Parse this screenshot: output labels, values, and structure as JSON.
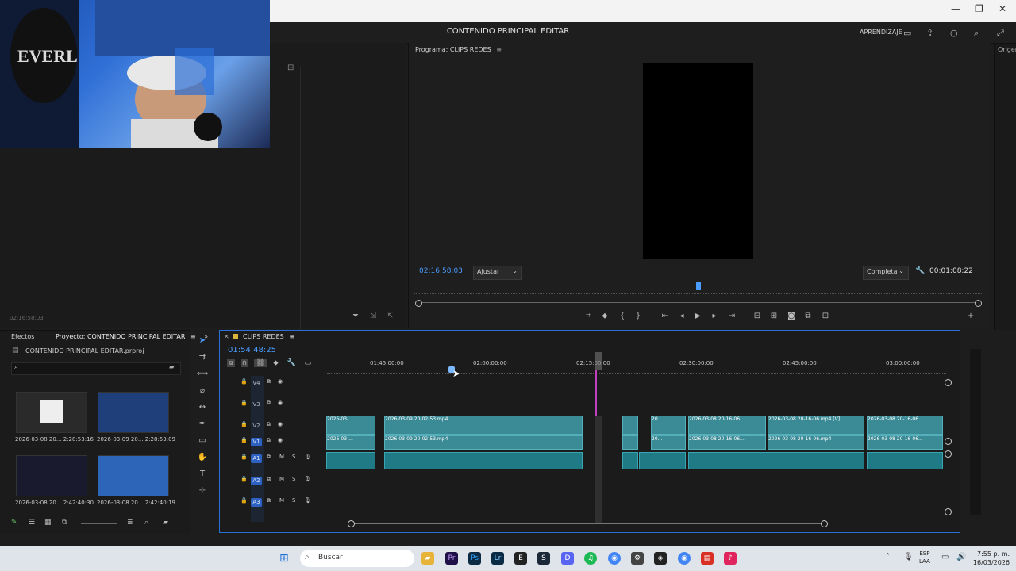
{
  "workspace": {
    "title": "CONTENIDO PRINCIPAL EDITAR",
    "learn": "APRENDIZAJE",
    "origin_label": "Origen:"
  },
  "program": {
    "title": "Programa: CLIPS REDES",
    "timecode": "02:16:58:03",
    "fit": "Ajustar",
    "resolution": "Completa",
    "duration": "00:01:08:22"
  },
  "source": {
    "timecode": "02:16:58:03"
  },
  "project": {
    "tab_effects": "Efectos",
    "tab_project": "Proyecto: CONTENIDO PRINCIPAL EDITAR",
    "file": "CONTENIDO PRINCIPAL EDITAR.prproj",
    "items": [
      {
        "name": "2026-03-08 20...",
        "dur": "2:28:53:16"
      },
      {
        "name": "2026-03-09 20...",
        "dur": "2:28:53:09"
      },
      {
        "name": "2026-03-08 20...",
        "dur": "2:42:40:30"
      },
      {
        "name": "2026-03-08 20...",
        "dur": "2:42:40:19"
      }
    ]
  },
  "timeline": {
    "title": "CLIPS REDES",
    "timecode": "01:54:48:25",
    "ruler": [
      "01:45:00:00",
      "02:00:00:00",
      "02:15:00:00",
      "02:30:00:00",
      "02:45:00:00",
      "03:00:00:00"
    ],
    "tracks": [
      {
        "name": "V4",
        "kind": "video"
      },
      {
        "name": "V3",
        "kind": "video"
      },
      {
        "name": "V2",
        "kind": "video"
      },
      {
        "name": "V1",
        "kind": "video"
      },
      {
        "name": "A1",
        "kind": "audio"
      },
      {
        "name": "A2",
        "kind": "audio"
      },
      {
        "name": "A3",
        "kind": "audio"
      }
    ],
    "clips_v2": [
      "2026-03-...",
      "2026-03-09 20-02-53.mp4",
      "20...",
      "2026-03-08 20-16-06...",
      "2026-03-08 20-16-06.mp4 [V]",
      "2026-03-08 20-16-06..."
    ],
    "clips_v1": [
      "2026-03-...",
      "2026-03-09 20-02-53.mp4",
      "20...",
      "2026-03-08 20-16-06...",
      "2026-03-08 20-16-06.mp4",
      "2026-03-08 20-16-06..."
    ]
  },
  "taskbar": {
    "search": "Buscar",
    "lang1": "ESP",
    "lang2": "LAA",
    "time": "7:55 p. m.",
    "date": "16/03/2026"
  },
  "colors": {
    "accent": "#4a9cff",
    "clip": "#3b8b96",
    "marker": "#c040c0"
  }
}
